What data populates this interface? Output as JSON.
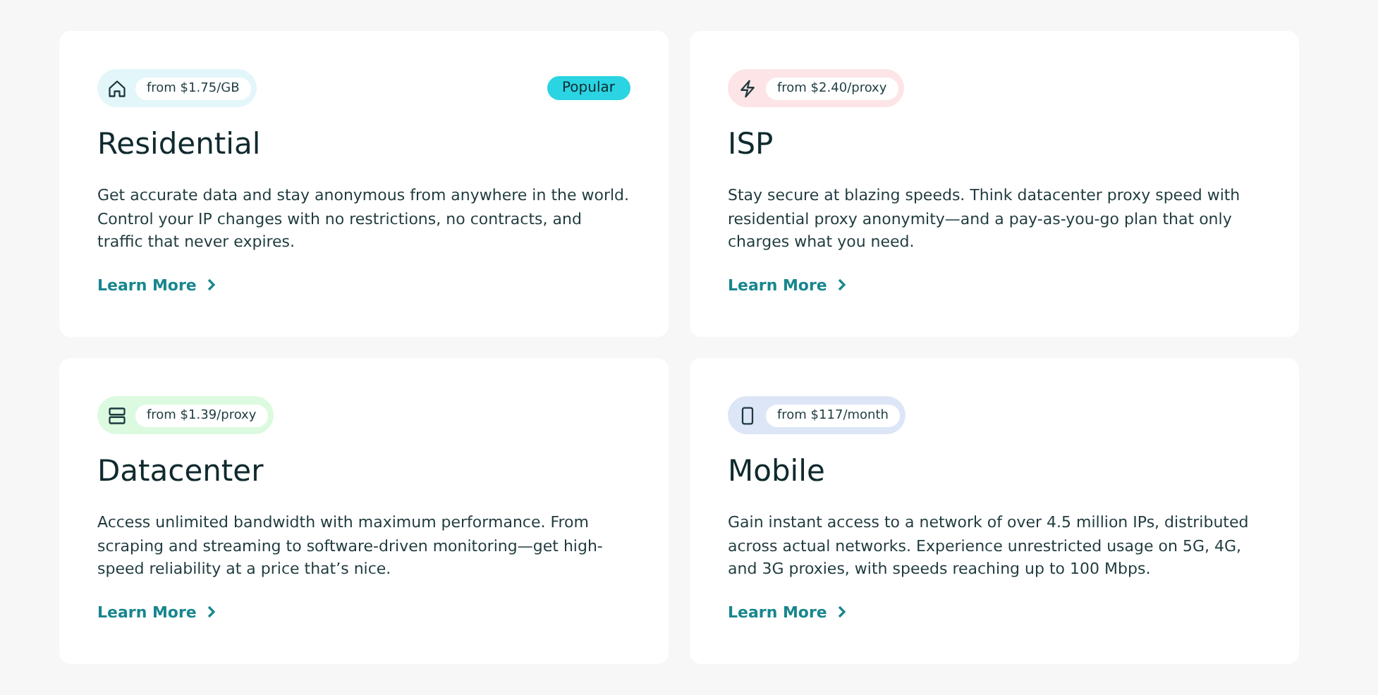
{
  "cards": [
    {
      "kind": "residential",
      "color": "#e3f6f9",
      "price": "from $1.75/GB",
      "badge": "Popular",
      "title": "Residential",
      "description": "Get accurate data and stay anonymous from anywhere in the world. Control your IP changes with no restrictions, no contracts, and traffic that never expires.",
      "link": "Learn More"
    },
    {
      "kind": "isp",
      "color": "#fde4e6",
      "price": "from $2.40/proxy",
      "title": "ISP",
      "description": "Stay secure at blazing speeds. Think datacenter proxy speed with residential proxy anonymity—and a pay-as-you-go plan that only charges what you need.",
      "link": "Learn More"
    },
    {
      "kind": "datacenter",
      "color": "#dcfadf",
      "price": "from $1.39/proxy",
      "title": "Datacenter",
      "description": "Access unlimited bandwidth with maximum performance. From scraping and streaming to software-driven monitoring—get high-speed reliability at a price that’s nice.",
      "link": "Learn More"
    },
    {
      "kind": "mobile",
      "color": "#dde6f6",
      "price": "from $117/month",
      "title": "Mobile",
      "description": "Gain instant access to a network of over 4.5 million IPs, distributed across actual networks. Experience unrestricted usage on 5G, 4G, and 3G proxies, with speeds reaching up to 100 Mbps.",
      "link": "Learn More"
    }
  ]
}
